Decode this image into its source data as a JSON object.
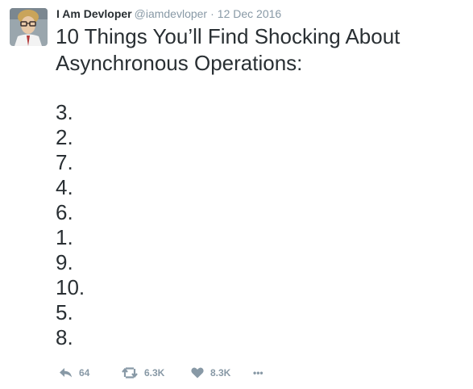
{
  "tweet": {
    "author_name": "I Am Devloper",
    "author_handle": "@iamdevloper",
    "separator": "·",
    "date": "12 Dec 2016",
    "title": "10 Things You’ll Find Shocking About Asynchronous Operations:",
    "list": [
      "3.",
      "2.",
      "7.",
      "4.",
      "6.",
      "1.",
      "9.",
      "10.",
      "5.",
      "8."
    ],
    "actions": {
      "reply_count": "64",
      "retweet_count": "6.3K",
      "like_count": "8.3K",
      "more_label": "•••"
    },
    "icons": {
      "reply": "reply-icon",
      "retweet": "retweet-icon",
      "like": "heart-icon",
      "more": "more-icon"
    },
    "colors": {
      "text": "#292f33",
      "muted": "#8899a6"
    }
  }
}
